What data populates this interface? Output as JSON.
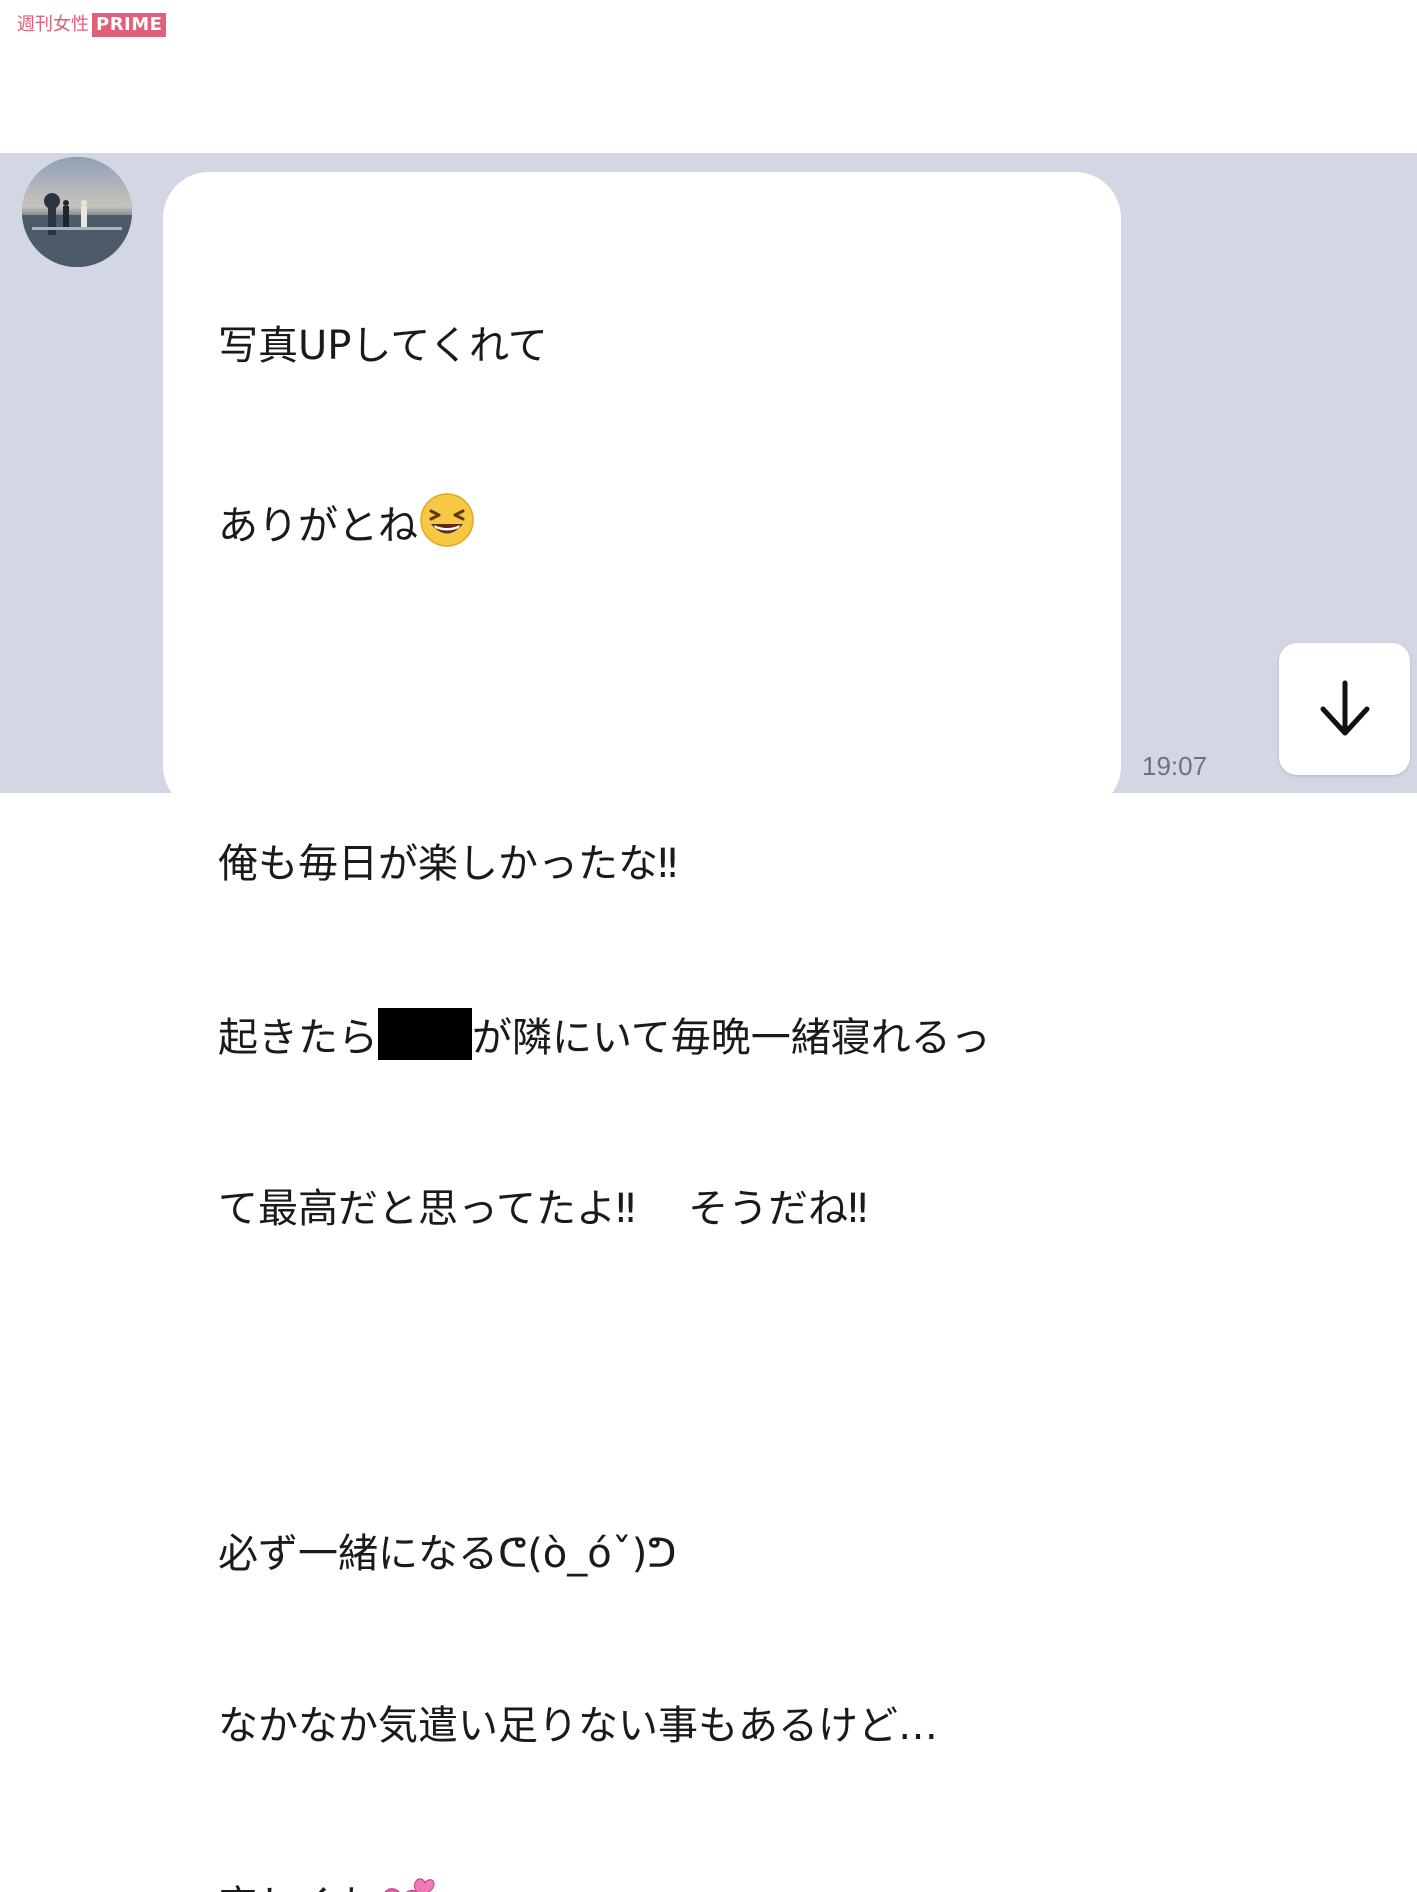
{
  "watermark": {
    "part1": "週刊女性",
    "part2": "PRIME"
  },
  "message": {
    "lines": [
      "写真UPしてくれて",
      "ありがとね",
      "",
      "俺も毎日が楽しかったな‼",
      "起きたら",
      "て最高だと思ってたよ‼　 そうだね‼",
      "",
      "必ず一緒になるᕦ(ò_óˇ)ᕤ",
      "なかなか気遣い足りない事もあるけど…",
      "宜しくね"
    ],
    "line5_after_redaction": "が隣にいて毎晩一緒寝れるっ",
    "emoji_1": "grinning-squinting-face",
    "emoji_2": "two-hearts",
    "time": "19:07"
  },
  "colors": {
    "chat_background": "#d2d7e3",
    "bubble": "#ffffff",
    "watermark_accent": "#e0607a"
  }
}
